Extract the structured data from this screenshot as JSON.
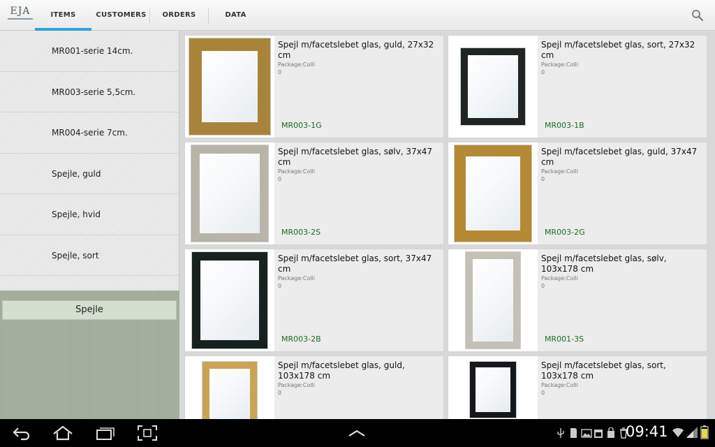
{
  "header": {
    "logo_text": "EJA",
    "tabs": [
      {
        "label": "ITEMS",
        "active": true
      },
      {
        "label": "CUSTOMERS",
        "active": false
      },
      {
        "label": "ORDERS",
        "active": false
      },
      {
        "label": "DATA",
        "active": false
      }
    ],
    "search_icon": "search-icon"
  },
  "sidebar": {
    "categories": [
      {
        "label": "MR001-serie 14cm."
      },
      {
        "label": "MR003-serie 5,5cm."
      },
      {
        "label": "MR004-serie 7cm."
      },
      {
        "label": "Spejle, guld"
      },
      {
        "label": "Spejle, hvid"
      },
      {
        "label": "Spejle, sort"
      }
    ],
    "group_label": "Spejle"
  },
  "items": [
    {
      "description": "Spejl m/facetslebet glas, guld, 27x32 cm",
      "package": "Package:Colli",
      "qty": "0",
      "code": "MR003-1G",
      "frame_color": "#a8843a"
    },
    {
      "description": "Spejl m/facetslebet glas, sort, 27x32 cm",
      "package": "Package:Colli",
      "qty": "0",
      "code": "MR003-1B",
      "frame_color": "#1f2622"
    },
    {
      "description": "Spejl m/facetslebet glas, sølv, 37x47 cm",
      "package": "Package:Colli",
      "qty": "0",
      "code": "MR003-2S",
      "frame_color": "#b8b4a8"
    },
    {
      "description": "Spejl m/facetslebet glas, guld, 37x47 cm",
      "package": "Package:Colli",
      "qty": "0",
      "code": "MR003-2G",
      "frame_color": "#b48a36"
    },
    {
      "description": "Spejl m/facetslebet glas, sort, 37x47 cm",
      "package": "Package:Colli",
      "qty": "0",
      "code": "MR003-2B",
      "frame_color": "#17221e"
    },
    {
      "description": "Spejl m/facetslebet glas, sølv, 103x178 cm",
      "package": "Package:Colli",
      "qty": "0",
      "code": "MR001-3S",
      "frame_color": "#c3c0b6"
    },
    {
      "description": "Spejl m/facetslebet glas, guld, 103x178 cm",
      "package": "Package:Colli",
      "qty": "0",
      "code": "",
      "frame_color": "#c8a458"
    },
    {
      "description": "Spejl m/facetslebet glas, sort, 103x178 cm",
      "package": "Package:Colli",
      "qty": "0",
      "code": "",
      "frame_color": "#15181a"
    }
  ],
  "statusbar": {
    "time": "09:41"
  },
  "colors": {
    "tab_accent": "#33a0d8",
    "code_green": "#1c6b25"
  }
}
